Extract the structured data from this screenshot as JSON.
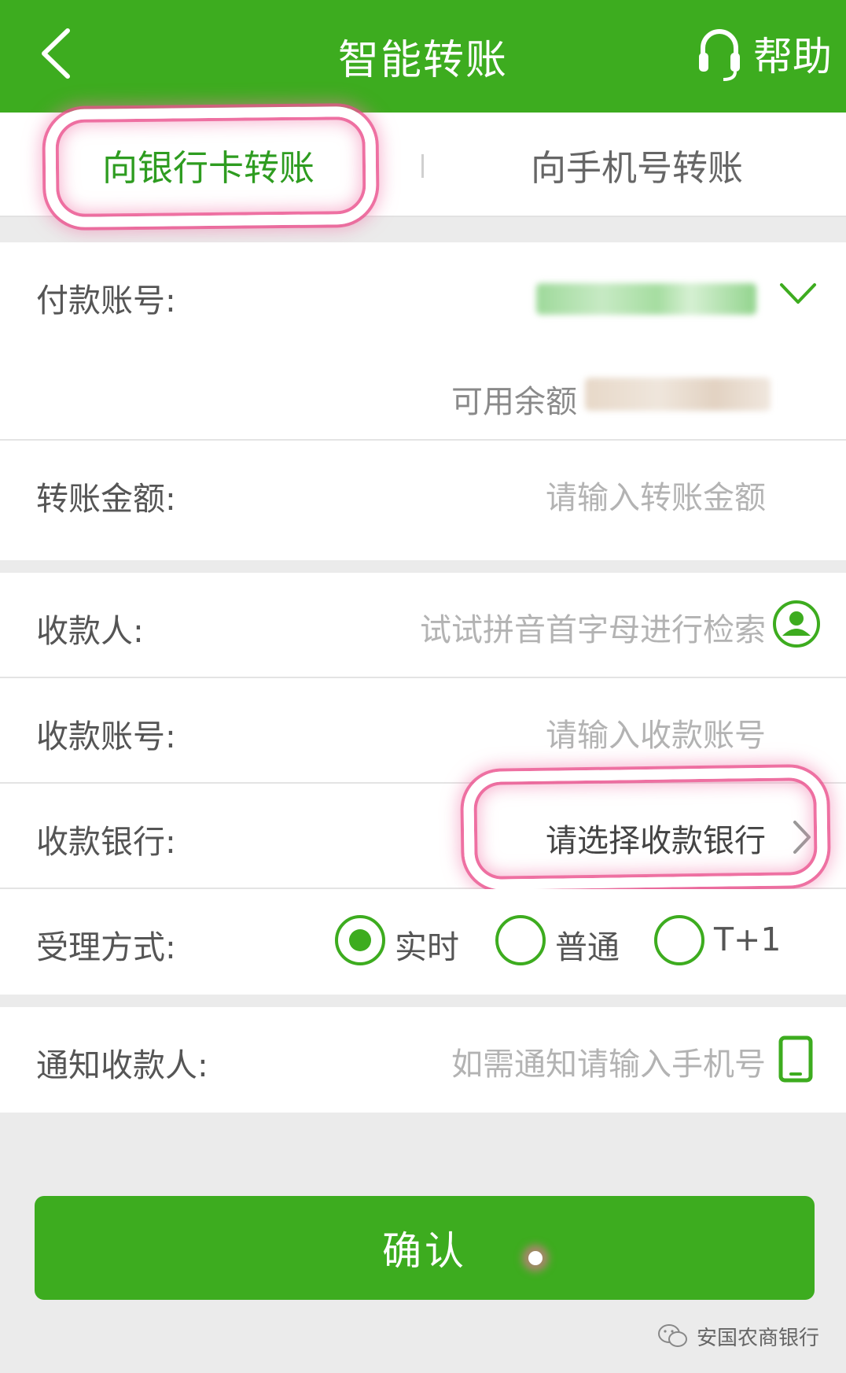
{
  "header": {
    "title": "智能转账",
    "help_label": "帮助"
  },
  "tabs": [
    {
      "label": "向银行卡转账",
      "active": true
    },
    {
      "label": "向手机号转账",
      "active": false
    }
  ],
  "form": {
    "payer_account": {
      "label": "付款账号:"
    },
    "available_balance": {
      "label": "可用余额"
    },
    "amount": {
      "label": "转账金额:",
      "placeholder": "请输入转账金额"
    },
    "payee": {
      "label": "收款人:",
      "placeholder": "试试拼音首字母进行检索"
    },
    "payee_account": {
      "label": "收款账号:",
      "placeholder": "请输入收款账号"
    },
    "payee_bank": {
      "label": "收款银行:",
      "placeholder": "请选择收款银行"
    },
    "processing_mode": {
      "label": "受理方式:",
      "options": [
        {
          "label": "实时",
          "selected": true
        },
        {
          "label": "普通",
          "selected": false
        },
        {
          "label": "T+1",
          "selected": false
        }
      ]
    },
    "notify": {
      "label": "通知收款人:",
      "placeholder": "如需通知请输入手机号"
    }
  },
  "confirm_label": "确认",
  "watermark": "安国农商银行",
  "colors": {
    "brand_green": "#3dac1f",
    "highlight_pink": "#e9508c"
  }
}
